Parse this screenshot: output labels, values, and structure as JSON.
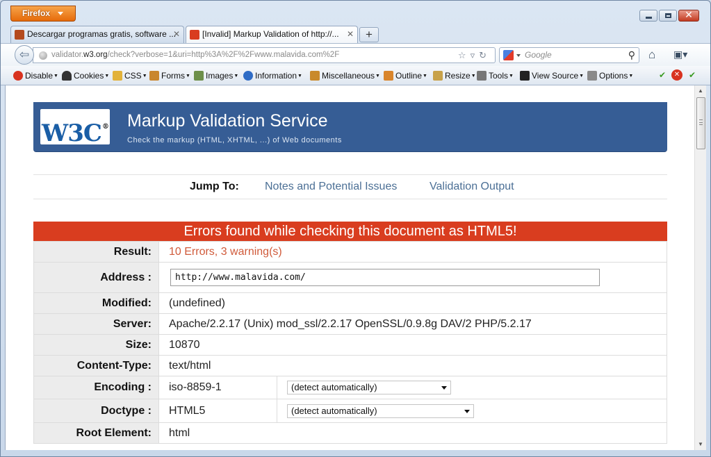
{
  "app": {
    "menu_button": "Firefox"
  },
  "tabs": [
    {
      "title": "Descargar programas gratis, software ...",
      "favicon_color": "#b44a1e"
    },
    {
      "title": "[Invalid] Markup Validation of http://...",
      "favicon_color": "#d93d1f"
    }
  ],
  "nav": {
    "url_host_prefix": "validator.",
    "url_host_main": "w3.org",
    "url_path": "/check?verbose=1&uri=http%3A%2F%2Fwww.malavida.com%2F",
    "search_placeholder": "Google"
  },
  "devbar": {
    "items": [
      "Disable",
      "Cookies",
      "CSS",
      "Forms",
      "Images",
      "Information",
      "Miscellaneous",
      "Outline",
      "Resize",
      "Tools",
      "View Source",
      "Options"
    ]
  },
  "banner": {
    "logo": "W3C",
    "title": "Markup Validation Service",
    "subtitle": "Check the markup (HTML, XHTML, ...) of Web documents"
  },
  "jump": {
    "label": "Jump To:",
    "links": [
      "Notes and Potential Issues",
      "Validation Output"
    ]
  },
  "results": {
    "heading": "Errors found while checking this document as HTML5!",
    "rows": {
      "result": {
        "label": "Result:",
        "value": "10 Errors, 3 warning(s)"
      },
      "address": {
        "label": "Address :",
        "value": "http://www.malavida.com/"
      },
      "modified": {
        "label": "Modified:",
        "value": "(undefined)"
      },
      "server": {
        "label": "Server:",
        "value": "Apache/2.2.17 (Unix) mod_ssl/2.2.17 OpenSSL/0.9.8g DAV/2 PHP/5.2.17"
      },
      "size": {
        "label": "Size:",
        "value": "10870"
      },
      "content_type": {
        "label": "Content-Type:",
        "value": "text/html"
      },
      "encoding": {
        "label": "Encoding :",
        "value": "iso-8859-1",
        "select": "(detect automatically)"
      },
      "doctype": {
        "label": "Doctype :",
        "value": "HTML5",
        "select": "(detect automatically)"
      },
      "root": {
        "label": "Root Element:",
        "value": "html"
      }
    }
  },
  "colors": {
    "banner": "#365d95",
    "error": "#d93d1f",
    "link": "#4b6f95"
  }
}
